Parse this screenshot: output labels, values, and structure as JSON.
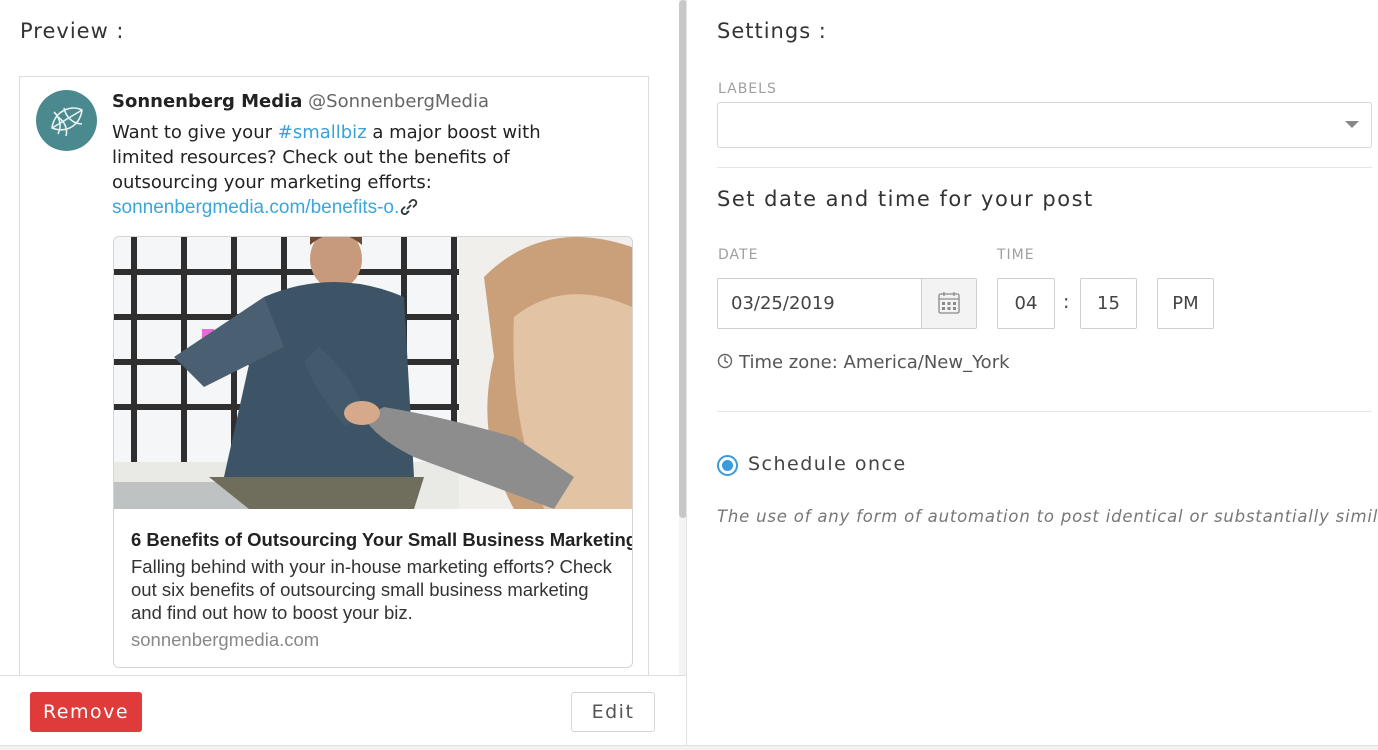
{
  "preview": {
    "title": "Preview :",
    "tweet": {
      "author_name": "Sonnenberg Media",
      "author_handle": "@SonnenbergMedia",
      "text_before": "Want to give your ",
      "hashtag": "#smallbiz",
      "text_after": " a major boost with limited resources? Check out the benefits of outsourcing your marketing efforts:",
      "link": "sonnenbergmedia.com/benefits-o...",
      "card": {
        "title": "6 Benefits of Outsourcing Your Small Business Marketing",
        "description": "Falling behind with your in-house marketing efforts? Check out six benefits of outsourcing small business marketing and find out how to boost your biz.",
        "domain": "sonnenbergmedia.com"
      }
    },
    "remove_label": "Remove",
    "edit_label": "Edit"
  },
  "settings": {
    "title": "Settings :",
    "labels_label": "LABELS",
    "labels_value": "",
    "datetime_heading": "Set date and time for your post",
    "date_label": "DATE",
    "time_label": "TIME",
    "date_value": "03/25/2019",
    "hour_value": "04",
    "time_separator": ":",
    "minute_value": "15",
    "ampm_value": "PM",
    "timezone": "Time zone: America/New_York",
    "schedule_label": "Schedule once",
    "schedule_selected": true,
    "disclaimer": "The use of any form of automation to post identical or substantially similar content is"
  },
  "colors": {
    "accent": "#3b9ad9",
    "link": "#3aa6da",
    "remove_button": "#e03b3b",
    "avatar": "#4a8a8e"
  },
  "icons": {
    "avatar": "leaf-logo-icon",
    "link": "link-icon",
    "calendar": "calendar-icon",
    "clock": "clock-icon",
    "labels_dropdown": "caret-down-icon"
  }
}
